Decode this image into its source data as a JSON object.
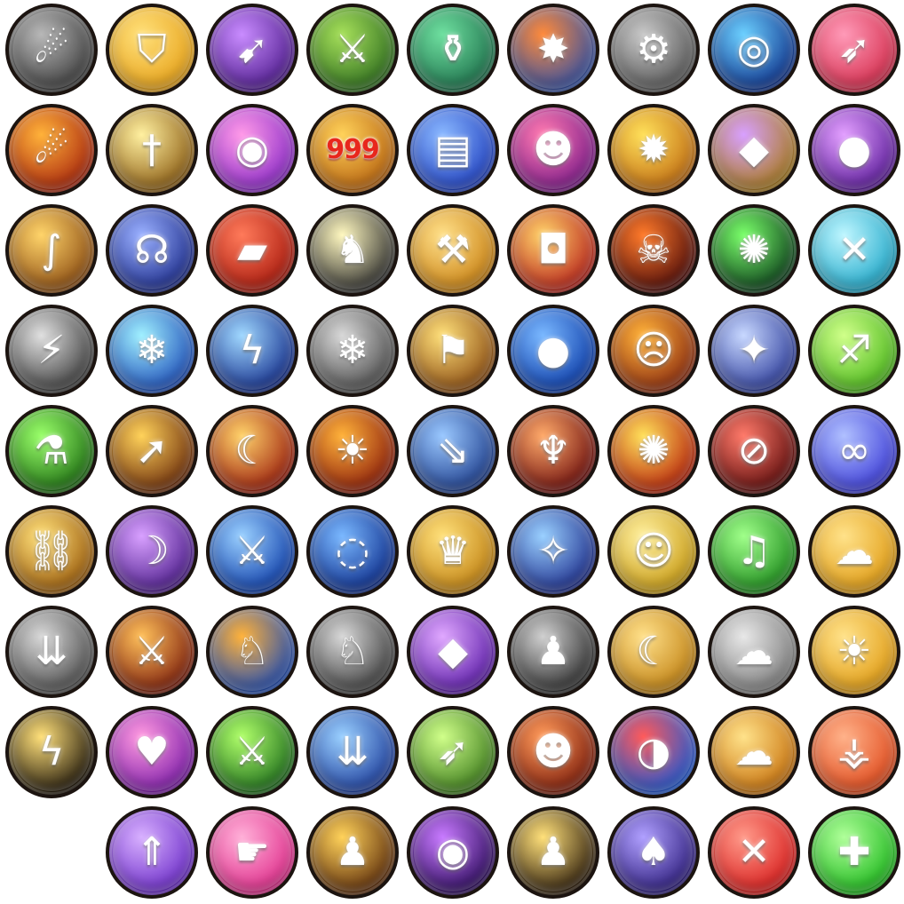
{
  "icons": [
    {
      "name": "falling-flames-grey-icon",
      "glyph": "☄",
      "c1": "#b8b8b8",
      "c2": "#3a3a3a",
      "row": 0,
      "col": 0
    },
    {
      "name": "golden-shield-icon",
      "glyph": "⛉",
      "c1": "#ffe07a",
      "c2": "#e7a117",
      "row": 0,
      "col": 1
    },
    {
      "name": "rocket-purple-icon",
      "glyph": "➹",
      "c1": "#c98cff",
      "c2": "#4d1a8c",
      "row": 0,
      "col": 2
    },
    {
      "name": "green-blade-fire-icon",
      "glyph": "⚔",
      "c1": "#a6e05a",
      "c2": "#2c6b1e",
      "row": 0,
      "col": 3
    },
    {
      "name": "green-bottle-icon",
      "glyph": "⚱",
      "c1": "#6fe0a0",
      "c2": "#1c6e4a",
      "row": 0,
      "col": 4
    },
    {
      "name": "fire-burst-blue-icon",
      "glyph": "✸",
      "c1": "#ff8a3a",
      "c2": "#2d4fa8",
      "row": 0,
      "col": 5
    },
    {
      "name": "grey-gear-mechanism-icon",
      "glyph": "⚙",
      "c1": "#c8c8c8",
      "c2": "#555555",
      "row": 0,
      "col": 6
    },
    {
      "name": "blue-whirlwind-icon",
      "glyph": "◎",
      "c1": "#6cd0ff",
      "c2": "#0d2f8a",
      "row": 0,
      "col": 7
    },
    {
      "name": "pink-dagger-icon",
      "glyph": "➶",
      "c1": "#ff9ab8",
      "c2": "#d42a4a",
      "row": 0,
      "col": 8
    },
    {
      "name": "fire-meteors-icon",
      "glyph": "☄",
      "c1": "#ffb23a",
      "c2": "#a8230c",
      "row": 1,
      "col": 0
    },
    {
      "name": "golden-sword-icon",
      "glyph": "†",
      "c1": "#fff0a0",
      "c2": "#8a5a10",
      "row": 1,
      "col": 1
    },
    {
      "name": "lollipop-candy-icon",
      "glyph": "◉",
      "c1": "#ff9ae8",
      "c2": "#8a2ac8",
      "row": 1,
      "col": 2
    },
    {
      "name": "dragon-999-icon",
      "glyph": "",
      "num": "999",
      "c1": "#ffd25a",
      "c2": "#b8620e",
      "row": 1,
      "col": 3
    },
    {
      "name": "blue-cards-icon",
      "glyph": "▤",
      "c1": "#8ab8ff",
      "c2": "#1f3fc0",
      "row": 1,
      "col": 4
    },
    {
      "name": "twin-girls-icon",
      "glyph": "☻",
      "c1": "#ff7ab0",
      "c2": "#7a1a8a",
      "row": 1,
      "col": 5
    },
    {
      "name": "golden-explosion-icon",
      "glyph": "✹",
      "c1": "#ffe05a",
      "c2": "#c06a10",
      "row": 1,
      "col": 6
    },
    {
      "name": "purple-crystal-blade-icon",
      "glyph": "◆",
      "c1": "#d8a0ff",
      "c2": "#a87a18",
      "row": 1,
      "col": 7
    },
    {
      "name": "dark-chick-silhouette-icon",
      "glyph": "●",
      "c1": "#e3a0ff",
      "c2": "#5a1a9a",
      "row": 1,
      "col": 8
    },
    {
      "name": "golden-staff-icon",
      "glyph": "∫",
      "c1": "#ffd46a",
      "c2": "#8a4a10",
      "row": 2,
      "col": 0
    },
    {
      "name": "blue-lightning-orb-icon",
      "glyph": "☊",
      "c1": "#9ab0ff",
      "c2": "#1a2a8a",
      "row": 2,
      "col": 1
    },
    {
      "name": "red-brick-icon",
      "glyph": "▰",
      "c1": "#ff7a5a",
      "c2": "#a8180c",
      "row": 2,
      "col": 2
    },
    {
      "name": "yellow-chick-icon",
      "glyph": "♞",
      "c1": "#fff8c0",
      "c2": "#2b2b2b",
      "row": 2,
      "col": 3
    },
    {
      "name": "battle-axe-icon",
      "glyph": "⚒",
      "c1": "#ffe08a",
      "c2": "#c98010",
      "row": 2,
      "col": 4
    },
    {
      "name": "barrel-icon",
      "glyph": "◘",
      "c1": "#ffd26a",
      "c2": "#b8201a",
      "row": 2,
      "col": 5
    },
    {
      "name": "demon-face-icon",
      "glyph": "☠",
      "c1": "#ff7a2a",
      "c2": "#4a0a0a",
      "row": 2,
      "col": 6
    },
    {
      "name": "shadow-spider-icon",
      "glyph": "✺",
      "c1": "#7aff6a",
      "c2": "#0a3a1a",
      "row": 2,
      "col": 7
    },
    {
      "name": "cyan-cross-arrows-icon",
      "glyph": "✕",
      "c1": "#bff6ff",
      "c2": "#1aa6c8",
      "row": 2,
      "col": 8
    },
    {
      "name": "grey-light-pillar-icon",
      "glyph": "⚡",
      "c1": "#e0e0e0",
      "c2": "#3a3a3a",
      "row": 3,
      "col": 0
    },
    {
      "name": "ice-crystals-icon",
      "glyph": "❄",
      "c1": "#a0f0ff",
      "c2": "#1a4ab8",
      "row": 3,
      "col": 1
    },
    {
      "name": "blue-lightning-strike-icon",
      "glyph": "ϟ",
      "c1": "#a0d8ff",
      "c2": "#102a8a",
      "row": 3,
      "col": 2
    },
    {
      "name": "grey-crystals-icon",
      "glyph": "❄",
      "c1": "#d8d8d8",
      "c2": "#4a4a4a",
      "row": 3,
      "col": 3
    },
    {
      "name": "blue-banner-burst-icon",
      "glyph": "⚑",
      "c1": "#ffe07a",
      "c2": "#8a4a10",
      "row": 3,
      "col": 4
    },
    {
      "name": "blue-orb-strike-icon",
      "glyph": "●",
      "c1": "#7ab8ff",
      "c2": "#0a3aa8",
      "row": 3,
      "col": 5
    },
    {
      "name": "angry-warrior-face-icon",
      "glyph": "☹",
      "c1": "#ffb23a",
      "c2": "#8a2a10",
      "row": 3,
      "col": 6
    },
    {
      "name": "shuriken-spread-icon",
      "glyph": "✦",
      "c1": "#c8d8ff",
      "c2": "#2a3a9a",
      "row": 3,
      "col": 7
    },
    {
      "name": "green-boot-icon",
      "glyph": "♐",
      "c1": "#d0ff8a",
      "c2": "#4ab81a",
      "row": 3,
      "col": 8
    },
    {
      "name": "green-potion-splash-icon",
      "glyph": "⚗",
      "c1": "#9aff6a",
      "c2": "#1a6a10",
      "row": 4,
      "col": 0
    },
    {
      "name": "golden-spear-icon",
      "glyph": "➚",
      "c1": "#ffd25a",
      "c2": "#6a2a0a",
      "row": 4,
      "col": 1
    },
    {
      "name": "golden-boomerang-icon",
      "glyph": "☾",
      "c1": "#ffd26a",
      "c2": "#9a1a0a",
      "row": 4,
      "col": 2
    },
    {
      "name": "fire-chick-screaming-icon",
      "glyph": "☀",
      "c1": "#ffb23a",
      "c2": "#8a1a0a",
      "row": 4,
      "col": 3
    },
    {
      "name": "triple-spears-icon",
      "glyph": "⇘",
      "c1": "#9ac8ff",
      "c2": "#1a3a8a",
      "row": 4,
      "col": 4
    },
    {
      "name": "twin-halberds-icon",
      "glyph": "♆",
      "c1": "#ffaa6a",
      "c2": "#6a0a0a",
      "row": 4,
      "col": 5
    },
    {
      "name": "fire-phoenix-icon",
      "glyph": "✺",
      "c1": "#ffe05a",
      "c2": "#b8200a",
      "row": 4,
      "col": 6
    },
    {
      "name": "no-sword-icon",
      "glyph": "⊘",
      "c1": "#ff7a6a",
      "c2": "#5a0a0a",
      "row": 4,
      "col": 7
    },
    {
      "name": "blue-swirl-icon",
      "glyph": "∞",
      "c1": "#b0c0ff",
      "c2": "#3a3ad8",
      "row": 4,
      "col": 8
    },
    {
      "name": "golden-chains-icon",
      "glyph": "⛓",
      "c1": "#ffe07a",
      "c2": "#9a5a0a",
      "row": 5,
      "col": 0
    },
    {
      "name": "purple-dagger-icon",
      "glyph": "☽",
      "c1": "#d8a0ff",
      "c2": "#4a1a8a",
      "row": 5,
      "col": 1
    },
    {
      "name": "blue-sabre-icon",
      "glyph": "⚔",
      "c1": "#9ad0ff",
      "c2": "#0a3aa8",
      "row": 5,
      "col": 2
    },
    {
      "name": "blue-vortex-icon",
      "glyph": "◌",
      "c1": "#7ab8ff",
      "c2": "#0a2a8a",
      "row": 5,
      "col": 3
    },
    {
      "name": "golden-crest-icon",
      "glyph": "♛",
      "c1": "#ffe07a",
      "c2": "#c08010",
      "row": 5,
      "col": 4
    },
    {
      "name": "blue-shatter-strike-icon",
      "glyph": "✧",
      "c1": "#9ad0ff",
      "c2": "#1a2a8a",
      "row": 5,
      "col": 5
    },
    {
      "name": "shouting-boy-icon",
      "glyph": "☺",
      "c1": "#fff0a0",
      "c2": "#c89a10",
      "row": 5,
      "col": 6
    },
    {
      "name": "green-horn-icon",
      "glyph": "♫",
      "c1": "#a0ff8a",
      "c2": "#1a8a1a",
      "row": 5,
      "col": 7
    },
    {
      "name": "golden-bun-icon",
      "glyph": "☁",
      "c1": "#ffe28a",
      "c2": "#e09a10",
      "row": 5,
      "col": 8
    },
    {
      "name": "grey-arrow-rain-icon",
      "glyph": "⇊",
      "c1": "#d8d8d8",
      "c2": "#4a4a4a",
      "row": 6,
      "col": 0
    },
    {
      "name": "fire-golden-sword-icon",
      "glyph": "⚔",
      "c1": "#ffc05a",
      "c2": "#7a1a0a",
      "row": 6,
      "col": 1
    },
    {
      "name": "rooster-icon",
      "glyph": "♘",
      "c1": "#ffb23a",
      "c2": "#1a4ab8",
      "row": 6,
      "col": 2
    },
    {
      "name": "grey-rooster-icon",
      "glyph": "♘",
      "c1": "#d8d8d8",
      "c2": "#3a3a3a",
      "row": 6,
      "col": 3
    },
    {
      "name": "purple-crystal-icon",
      "glyph": "◆",
      "c1": "#e0a8ff",
      "c2": "#5a1aa8",
      "row": 6,
      "col": 4
    },
    {
      "name": "shadow-army-grey-icon",
      "glyph": "♟",
      "c1": "#d0d0d0",
      "c2": "#2a2a2a",
      "row": 6,
      "col": 5
    },
    {
      "name": "golden-scimitar-icon",
      "glyph": "☾",
      "c1": "#ffe08a",
      "c2": "#c08010",
      "row": 6,
      "col": 6
    },
    {
      "name": "grey-steamer-buns-icon",
      "glyph": "☁",
      "c1": "#e8e8e8",
      "c2": "#7a7a7a",
      "row": 6,
      "col": 7
    },
    {
      "name": "golden-bun-glow-icon",
      "glyph": "☀",
      "c1": "#ffe28a",
      "c2": "#e09a10",
      "row": 6,
      "col": 8
    },
    {
      "name": "golden-lightning-icon",
      "glyph": "ϟ",
      "c1": "#ffe07a",
      "c2": "#1a1208",
      "row": 7,
      "col": 0
    },
    {
      "name": "pink-hearts-fan-icon",
      "glyph": "♥",
      "c1": "#ff9ae0",
      "c2": "#7a1aa8",
      "row": 7,
      "col": 1
    },
    {
      "name": "green-golden-blade-icon",
      "glyph": "⚔",
      "c1": "#b0ff6a",
      "c2": "#1a6a1a",
      "row": 7,
      "col": 2
    },
    {
      "name": "blue-arrow-volley-icon",
      "glyph": "⇊",
      "c1": "#9ad0ff",
      "c2": "#1a3a9a",
      "row": 7,
      "col": 3
    },
    {
      "name": "green-spear-swirl-icon",
      "glyph": "➶",
      "c1": "#d0ff8a",
      "c2": "#3a7a1a",
      "row": 7,
      "col": 4
    },
    {
      "name": "red-gear-face-icon",
      "glyph": "☻",
      "c1": "#ff9a5a",
      "c2": "#7a1a0a",
      "row": 7,
      "col": 5
    },
    {
      "name": "red-blue-coin-icon",
      "glyph": "◑",
      "c1": "#ff5a5a",
      "c2": "#1a5ad8",
      "row": 7,
      "col": 6
    },
    {
      "name": "golden-steamer-buns-icon",
      "glyph": "☁",
      "c1": "#ffe28a",
      "c2": "#c8700a",
      "row": 7,
      "col": 7
    },
    {
      "name": "orange-rune-icon",
      "glyph": "⚶",
      "c1": "#ffb28a",
      "c2": "#e0481a",
      "row": 7,
      "col": 8
    },
    {
      "name": "purple-up-arrows-icon",
      "glyph": "⇑",
      "c1": "#d8b0ff",
      "c2": "#6a2ac8",
      "row": 8,
      "col": 1
    },
    {
      "name": "pink-bird-head-icon",
      "glyph": "☛",
      "c1": "#ffb0d8",
      "c2": "#e02a8a",
      "row": 8,
      "col": 2
    },
    {
      "name": "golden-silhouette-icon",
      "glyph": "♟",
      "c1": "#ffd25a",
      "c2": "#5a2a0a",
      "row": 8,
      "col": 3
    },
    {
      "name": "purple-dark-vortex-icon",
      "glyph": "◉",
      "c1": "#c87aff",
      "c2": "#2a0a5a",
      "row": 8,
      "col": 4
    },
    {
      "name": "shadow-army-golden-icon",
      "glyph": "♟",
      "c1": "#ffe07a",
      "c2": "#2a1a0a",
      "row": 8,
      "col": 5
    },
    {
      "name": "purple-cards-fan-icon",
      "glyph": "♠",
      "c1": "#b0a0ff",
      "c2": "#2a1a7a",
      "row": 8,
      "col": 6
    },
    {
      "name": "red-crossed-swords-icon",
      "glyph": "✕",
      "c1": "#ff9a8a",
      "c2": "#d81a1a",
      "row": 8,
      "col": 7
    },
    {
      "name": "green-heal-cross-icon",
      "glyph": "✚",
      "c1": "#b0ff9a",
      "c2": "#1ab81a",
      "row": 8,
      "col": 8
    }
  ]
}
